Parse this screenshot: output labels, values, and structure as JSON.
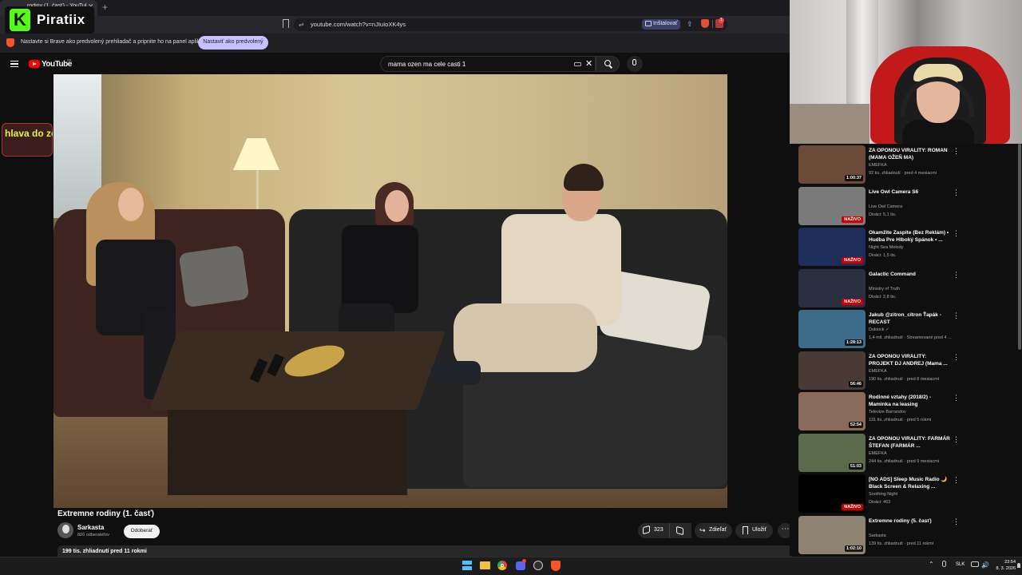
{
  "browser": {
    "tab_title": "rodiny (1. časť) - YouTube",
    "new_tab_icon": "+",
    "url": "youtube.com/watch?v=nJIuIoXK4ys",
    "install_label": "Inštalovať",
    "ext_badge": "1",
    "info_text": "Nastavte si Brave ako predvolený prehliadač a pripnite ho na panel aplikácií",
    "info_button": "Nastaviť ako predvolený",
    "accent_color": "#c9c1ff"
  },
  "youtube": {
    "logo_text": "YouTube",
    "country_code": "SK",
    "search_query": "mama ozen ma cele casti 1",
    "clear_icon": "✕"
  },
  "overlay": {
    "streamer_k": "K",
    "streamer_name": "Piratiix",
    "left_text": "hlava do ze"
  },
  "video": {
    "title": "Extremne rodiny (1. časť)",
    "channel": "Sarkasta",
    "subscribers": "826 odberateľov",
    "subscribe_label": "Odoberať",
    "likes": "323",
    "share_icon": "↪",
    "share_label": "Zdieľať",
    "save_label": "Uložiť",
    "more_icon": "⋯",
    "meta": "199 tis. zhliadnutí  pred 11 rokmi"
  },
  "recommendations": [
    {
      "title": "ZA OPONOU VIRALITY: ROMAN (MAMA OŽEŇ MA)",
      "channel": "EMEFKA",
      "meta": "92 tis. zhliadnutí · pred 4 mesiacmi",
      "duration": "1:00:37",
      "live": false,
      "thumb": "#6b4a3a"
    },
    {
      "title": "Live Owl Camera S6",
      "channel": "Live Owl Camera",
      "meta": "Diváci: 5,1 tis.",
      "duration": "NAŽIVO",
      "live": true,
      "thumb": "#7a7a7a"
    },
    {
      "title": "Okamžite Zaspite (Bez Reklám) • Hudba Pre Hlboký Spánok • ...",
      "channel": "Night Sea Melody",
      "meta": "Diváci: 1,5 tis.",
      "duration": "NAŽIVO",
      "live": true,
      "thumb": "#1e2d5a"
    },
    {
      "title": "Galactic Command",
      "channel": "Ministry of Truth",
      "meta": "Diváci: 2,8 tis.",
      "duration": "NAŽIVO",
      "live": true,
      "thumb": "#2a3040"
    },
    {
      "title": "Jakub @zitron_citron  Ťapák - RECAST",
      "channel": "Dukiock ✓",
      "meta": "1,4 mil. zhliadnutí · Streamované pred 4 ...",
      "duration": "1:28:13",
      "live": false,
      "thumb": "#3c6c8a"
    },
    {
      "title": "ZA OPONOU VIRALITY: PROJEKT DJ ANDREJ (Mama ...",
      "channel": "EMEFKA",
      "meta": "190 tis. zhliadnutí · pred 8 mesiacmi",
      "duration": "56:46",
      "live": false,
      "thumb": "#4a3a36"
    },
    {
      "title": "Rodinné vztahy (2018/2) - Maminka na leasing",
      "channel": "Televize Barrandov",
      "meta": "131 tis. zhliadnutí · pred 5 rokmi",
      "duration": "52:54",
      "live": false,
      "thumb": "#8a6a5a"
    },
    {
      "title": "ZA OPONOU VIRALITY: FARMÁR ŠTEFAN (FARMÁR ...",
      "channel": "EMEFKA",
      "meta": "244 tis. zhliadnutí · pred 9 mesiacmi",
      "duration": "51:03",
      "live": false,
      "thumb": "#5a6a4a"
    },
    {
      "title": "[NO ADS] Sleep Music Radio 🌙 Black Screen & Relaxing ...",
      "channel": "Soothing Night",
      "meta": "Diváci: 463",
      "duration": "NAŽIVO",
      "live": true,
      "thumb": "#000000"
    },
    {
      "title": "Extremne rodiny (5. časť)",
      "channel": "Sarkasta",
      "meta": "139 tis. zhliadnutí · pred 11 rokmi",
      "duration": "1:02:10",
      "live": false,
      "thumb": "#8e8272"
    }
  ],
  "live_label": "NAŽIVO",
  "more_dots": "⋮",
  "taskbar": {
    "tray_chevron": "⌃",
    "lang": "SLK",
    "volume_icon": "🔊",
    "time": "23:54",
    "date": "8. 3. 2026"
  }
}
